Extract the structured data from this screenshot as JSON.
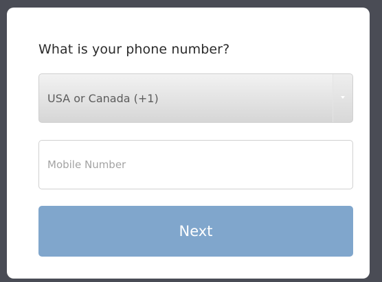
{
  "form": {
    "title": "What is your phone number?",
    "country_select": {
      "selected": "USA or Canada (+1)"
    },
    "mobile_input": {
      "value": "",
      "placeholder": "Mobile Number"
    },
    "next_label": "Next"
  },
  "colors": {
    "background": "#4a4c55",
    "card": "#ffffff",
    "button": "#80a6cc",
    "button_text": "#ffffff"
  },
  "icons": {
    "select_arrow": "caret-down-icon"
  }
}
